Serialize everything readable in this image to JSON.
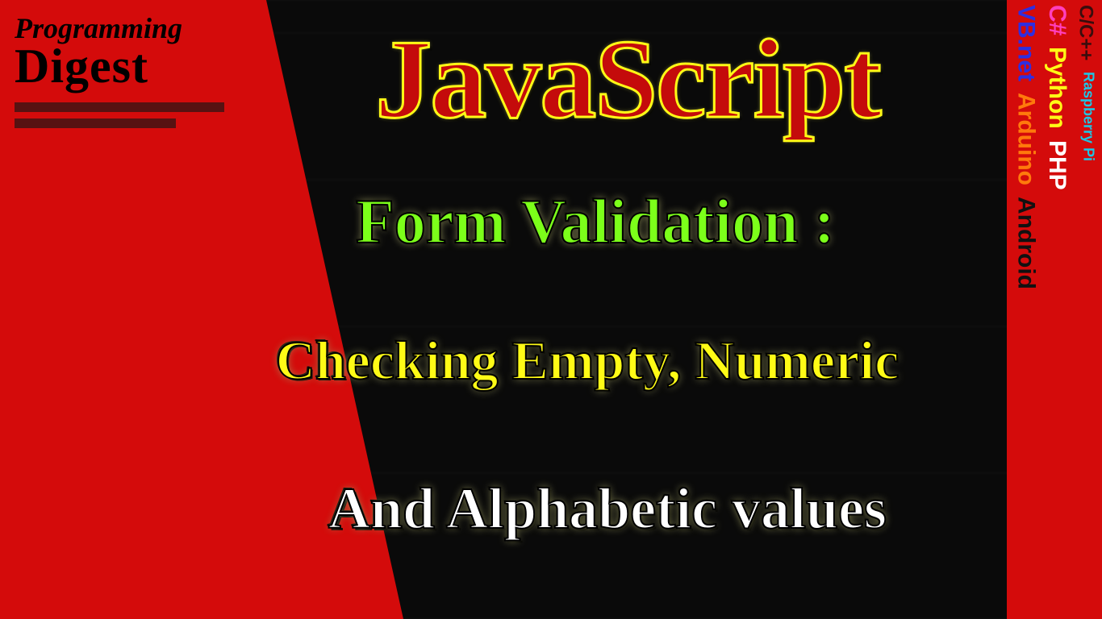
{
  "logo": {
    "line1": "Programming",
    "line2": "Digest"
  },
  "title": "JavaScript",
  "subtitle1": "Form Validation :",
  "subtitle2": "Checking Empty, Numeric",
  "subtitle3": "And Alphabetic values",
  "tags": {
    "col1": [
      "VB.net",
      "Arduino",
      "Android"
    ],
    "col2": [
      "C#",
      "Python",
      "PHP"
    ],
    "col3": [
      "C/C++",
      "Raspberry Pi"
    ]
  }
}
